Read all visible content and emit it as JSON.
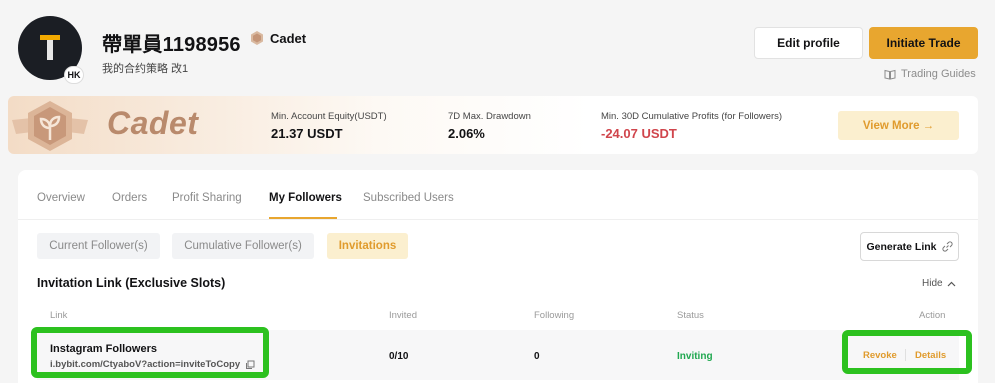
{
  "profile": {
    "name": "帶單員1198956",
    "region_badge": "HK",
    "rank": "Cadet",
    "bio": "我的合约策略 改1"
  },
  "header_actions": {
    "edit_profile": "Edit profile",
    "initiate_trade": "Initiate Trade",
    "trading_guides": "Trading Guides"
  },
  "banner": {
    "rank": "Cadet",
    "metrics": [
      {
        "label": "Min. Account Equity(USDT)",
        "value": "21.37 USDT"
      },
      {
        "label": "7D Max. Drawdown",
        "value": "2.06%"
      },
      {
        "label": "Min. 30D Cumulative Profits (for Followers)",
        "value": "-24.07 USDT"
      }
    ],
    "view_more": "View More →"
  },
  "tabs": [
    "Overview",
    "Orders",
    "Profit Sharing",
    "My Followers",
    "Subscribed Users"
  ],
  "active_tab": "My Followers",
  "filters": [
    "Current Follower(s)",
    "Cumulative Follower(s)",
    "Invitations"
  ],
  "active_filter": "Invitations",
  "generate_link": "Generate Link",
  "section": {
    "title": "Invitation Link (Exclusive Slots)",
    "toggle": "Hide"
  },
  "table": {
    "columns": [
      "Link",
      "Invited",
      "Following",
      "Status",
      "Action"
    ],
    "rows": [
      {
        "name": "Instagram Followers",
        "url": "i.bybit.com/CtyaboV?action=inviteToCopy",
        "invited": "0/10",
        "following": "0",
        "status": "Inviting",
        "actions": [
          "Revoke",
          "Details"
        ]
      }
    ]
  },
  "colors": {
    "accent": "#e8a62f",
    "status_ok": "#20a850",
    "negative": "#d0454c",
    "highlight": "#2cc11f"
  }
}
